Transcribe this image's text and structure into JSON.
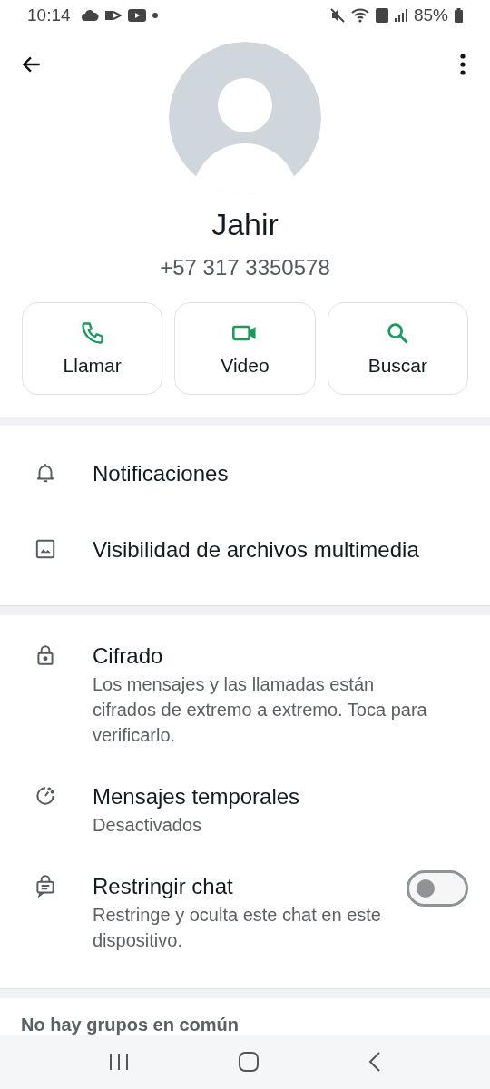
{
  "status_bar": {
    "time": "10:14",
    "battery": "85%"
  },
  "contact": {
    "name": "Jahir",
    "phone": "+57 317 3350578"
  },
  "actions": [
    {
      "label": "Llamar"
    },
    {
      "label": "Video"
    },
    {
      "label": "Buscar"
    }
  ],
  "sections": [
    {
      "items": [
        {
          "kind": "item",
          "title": "Notificaciones"
        },
        {
          "kind": "item",
          "title": "Visibilidad de archivos multimedia"
        }
      ]
    },
    {
      "items": [
        {
          "kind": "item",
          "title": "Cifrado",
          "subtitle": "Los mensajes y las llamadas están cifrados de extremo a extremo. Toca para verificarlo."
        },
        {
          "kind": "item",
          "title": "Mensajes temporales",
          "subtitle": "Desactivados"
        },
        {
          "kind": "toggle",
          "title": "Restringir chat",
          "subtitle": "Restringe y oculta este chat en este dispositivo.",
          "on": false
        }
      ]
    }
  ],
  "groups_note": "No hay grupos en común"
}
